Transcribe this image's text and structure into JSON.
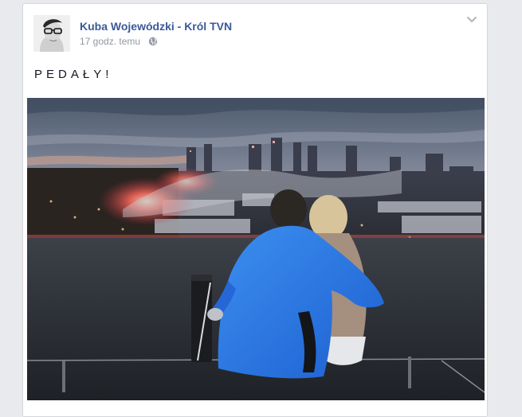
{
  "post": {
    "author": "Kuba Wojewódzki - Król TVN",
    "timestamp": "17 godz. temu",
    "audience_icon": "globe-icon",
    "menu_icon": "chevron-down-icon",
    "text": "PEDAŁY!"
  },
  "photo": {
    "description_icon": "rooftop-couple-city-flares-photo"
  },
  "colors": {
    "page_bg": "#e9eaed",
    "card_bg": "#ffffff",
    "author_link": "#3b5998",
    "meta_text": "#9197a3"
  }
}
